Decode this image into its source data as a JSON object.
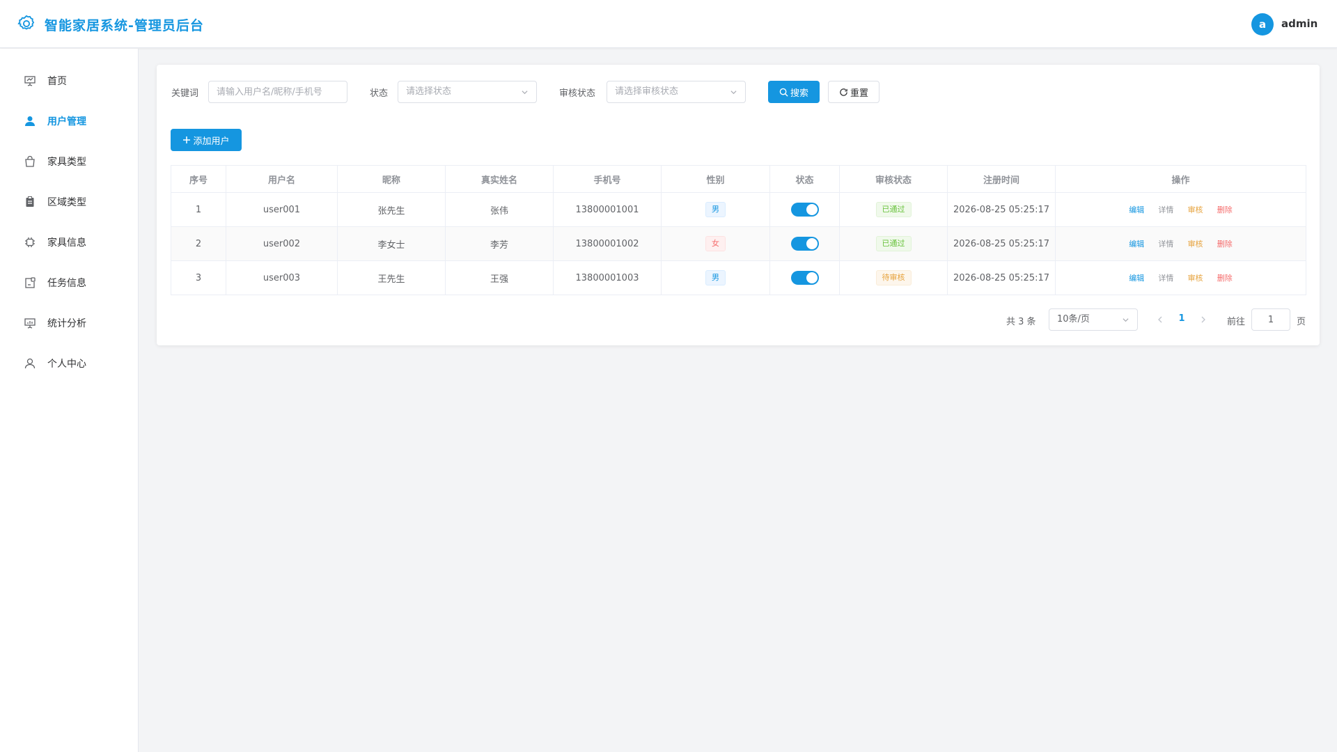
{
  "header": {
    "title": "智能家居系统-管理员后台",
    "avatar_letter": "a",
    "username": "admin"
  },
  "sidebar": {
    "items": [
      {
        "label": "首页",
        "icon": "presentation-icon"
      },
      {
        "label": "用户管理",
        "icon": "user-filled-icon",
        "active": true
      },
      {
        "label": "家具类型",
        "icon": "shopping-bag-icon"
      },
      {
        "label": "区域类型",
        "icon": "clipboard-icon"
      },
      {
        "label": "家具信息",
        "icon": "cpu-icon"
      },
      {
        "label": "任务信息",
        "icon": "task-icon"
      },
      {
        "label": "统计分析",
        "icon": "chart-board-icon"
      },
      {
        "label": "个人中心",
        "icon": "user-icon"
      }
    ]
  },
  "filters": {
    "keyword_label": "关键词",
    "keyword_placeholder": "请输入用户名/昵称/手机号",
    "status_label": "状态",
    "status_placeholder": "请选择状态",
    "audit_label": "审核状态",
    "audit_placeholder": "请选择审核状态",
    "search_label": "搜索",
    "reset_label": "重置"
  },
  "add_user_label": "添加用户",
  "table": {
    "columns": [
      "序号",
      "用户名",
      "昵称",
      "真实姓名",
      "手机号",
      "性别",
      "状态",
      "审核状态",
      "注册时间",
      "操作"
    ],
    "rows": [
      {
        "index": "1",
        "username": "user001",
        "nickname": "张先生",
        "realname": "张伟",
        "phone": "13800001001",
        "gender": "男",
        "enabled": true,
        "audit": "已通过",
        "registered": "2026-08-25 05:25:17"
      },
      {
        "index": "2",
        "username": "user002",
        "nickname": "李女士",
        "realname": "李芳",
        "phone": "13800001002",
        "gender": "女",
        "enabled": true,
        "audit": "已通过",
        "registered": "2026-08-25 05:25:17"
      },
      {
        "index": "3",
        "username": "user003",
        "nickname": "王先生",
        "realname": "王强",
        "phone": "13800001003",
        "gender": "男",
        "enabled": true,
        "audit": "待审核",
        "registered": "2026-08-25 05:25:17"
      }
    ],
    "actions": {
      "edit": "编辑",
      "detail": "详情",
      "audit": "审核",
      "delete": "删除"
    }
  },
  "pagination": {
    "total_text": "共 3 条",
    "page_size": "10条/页",
    "current_page": "1",
    "goto_label": "前往",
    "goto_value": "1",
    "page_suffix": "页"
  },
  "colors": {
    "primary": "#1596e0",
    "danger": "#f56c6c",
    "warning": "#e6a23c",
    "success": "#67c23a"
  }
}
